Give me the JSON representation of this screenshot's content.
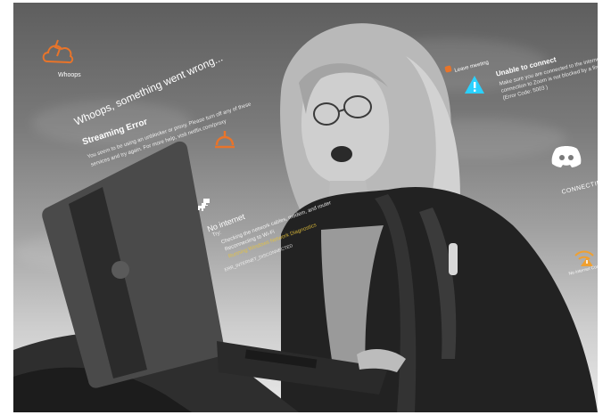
{
  "errors": {
    "whoops_label": "Whoops",
    "headline": "Whoops, something went wrong...",
    "streaming_title": "Streaming Error",
    "streaming_body_1": "You seem to be using an unblocker or proxy. Please turn off any of these",
    "streaming_body_2": "services and try again. For more help, visit netflix.com/proxy",
    "no_internet_title": "No internet",
    "try_label": "Try:",
    "tip_1": "Checking the network cables, modem, and router",
    "tip_2": "Reconnecting to Wi-Fi",
    "tip_3": "Running Windows Network Diagnostics",
    "error_code": "ERR_INTERNET_DISCONNECTED",
    "leave_meeting": "Leave meeting",
    "unable_title": "Unable to connect",
    "unable_body_1": "Make sure you are connected to the internet and your",
    "unable_body_2": "connection to Zoom is not blocked by a firewall or proxy.",
    "unable_body_3": "(Error Code: 5003 )",
    "connecting": "CONNECTING...",
    "no_internet_connection": "No internet Connection"
  },
  "colors": {
    "accent_orange": "#e8742a",
    "warning_blue": "#2ad1ff",
    "tip_yellow": "#e8c43a",
    "wifi_warn": "#f0a030"
  }
}
